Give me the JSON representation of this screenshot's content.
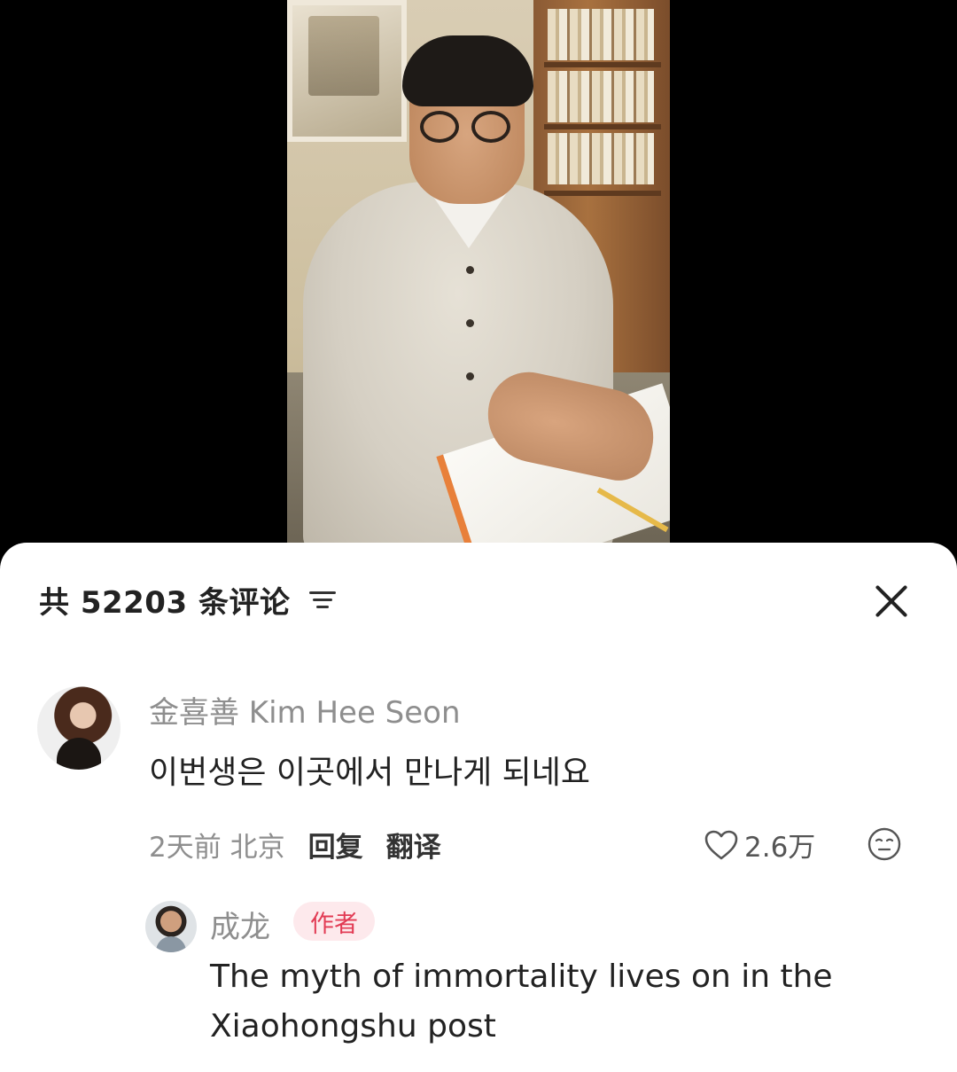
{
  "sheet": {
    "title": "共 52203 条评论",
    "sort_icon": "sort-lines-icon",
    "close_icon": "close-icon"
  },
  "comment": {
    "username": "金喜善 Kim Hee Seon",
    "text": "이번생은 이곳에서 만나게 되네요",
    "time_location": "2天前 北京",
    "reply_label": "回复",
    "translate_label": "翻译",
    "like_count": "2.6万",
    "like_icon": "heart-outline-icon",
    "emoji_icon": "emoji-face-icon"
  },
  "reply": {
    "username": "成龙",
    "badge": "作者",
    "text": "The myth of immortality lives on in the Xiaohongshu post"
  },
  "colors": {
    "badge_bg": "#fde9ec",
    "badge_text": "#e23b54",
    "muted_text": "#8e8e8e"
  }
}
